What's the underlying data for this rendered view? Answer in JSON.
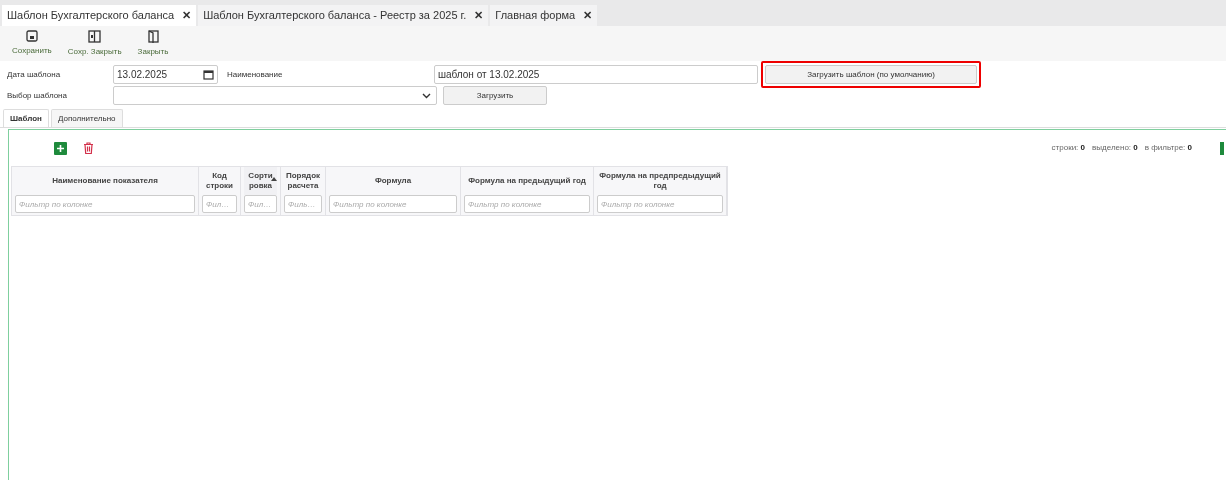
{
  "tabs": [
    {
      "label": "Шаблон Бухгалтерского баланса",
      "close": "✕",
      "selected": true
    },
    {
      "label": "Шаблон Бухгалтерского баланса - Реестр за 2025 г.",
      "close": "✕",
      "selected": false
    },
    {
      "label": "Главная форма",
      "close": "✕",
      "selected": false
    }
  ],
  "toolbar": [
    {
      "kind": "save",
      "label": "Сохранить"
    },
    {
      "kind": "save_close",
      "label": "Сохр. Закрыть"
    },
    {
      "kind": "close",
      "label": "Закрыть"
    }
  ],
  "form": {
    "date_label": "Дата шаблона",
    "date_value": "13.02.2025",
    "name_label": "Наименование",
    "name_value": "шаблон от 13.02.2025",
    "load_default_button": "Загрузить шаблон (по умолчанию)",
    "load_default_highlighted": true,
    "template_label": "Выбор шаблона",
    "load_button": "Загрузить"
  },
  "subtabs": [
    {
      "label": "Шаблон",
      "selected": true
    },
    {
      "label": "Дополнительно",
      "selected": false
    }
  ],
  "stats": [
    {
      "label": "строки:",
      "value": "0"
    },
    {
      "label": "выделено:",
      "value": "0"
    },
    {
      "label": "в фильтре:",
      "value": "0"
    }
  ],
  "table": {
    "columns": [
      {
        "title": "Наименование показателя",
        "placeholder": "Фильтр по колонке",
        "sorted": false
      },
      {
        "title": "Код строки",
        "placeholder": "Фил…",
        "sorted": false
      },
      {
        "title": "Сорти ровка",
        "placeholder": "Фил…",
        "sorted": true
      },
      {
        "title": "Порядок расчета",
        "placeholder": "Филь…",
        "sorted": false
      },
      {
        "title": "Формула",
        "placeholder": "Фильтр по колонке",
        "sorted": false
      },
      {
        "title": "Формула на предыдущий год",
        "placeholder": "Фильтр по колонке",
        "sorted": false
      },
      {
        "title": "Формула на предпредыдущий год",
        "placeholder": "Фильтр по колонке",
        "sorted": false
      }
    ]
  }
}
